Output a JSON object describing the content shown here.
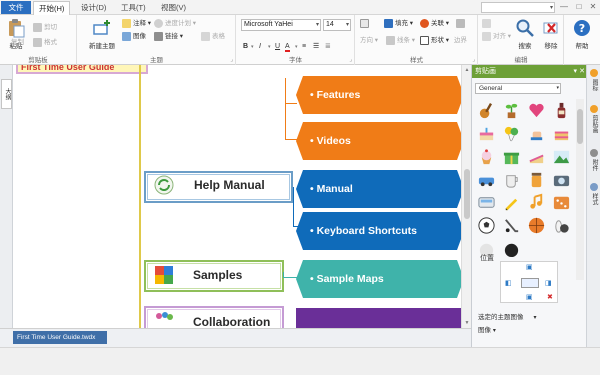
{
  "menu": {
    "file": "文件(F)",
    "start": "开始(H)",
    "design": "设计(D)",
    "tools": "工具(T)",
    "view": "视图(V)"
  },
  "window": {
    "minimize": "—",
    "restore": "□",
    "close": "✕"
  },
  "ribbon": {
    "clipboard": {
      "paste": "粘贴",
      "copy": "复制",
      "cut": "剪切",
      "format_painter": "格式",
      "label": "剪贴板"
    },
    "topic": {
      "new_topic": "新建主题",
      "note": "注释",
      "progress": "进度计划",
      "image": "图像",
      "link": "链接",
      "table": "表格",
      "label": "主题"
    },
    "font": {
      "family": "Microsoft YaHei",
      "size": "14",
      "bold": "B",
      "italic": "I",
      "underline": "U",
      "label": "字体"
    },
    "style": {
      "fill": "填充",
      "connect": "关联",
      "direction": "方向",
      "line_color": "线条",
      "shape": "形状",
      "border": "边界",
      "label": "样式"
    },
    "edit": {
      "align": "对齐",
      "search": "搜索",
      "remove": "移除",
      "label": "编辑"
    },
    "help": {
      "help": "帮助"
    }
  },
  "left_panel": {
    "tab": "大纲"
  },
  "canvas": {
    "top_topic": "First Time User Guide",
    "topics": [
      {
        "label": "Help Manual"
      },
      {
        "label": "Samples"
      },
      {
        "label": "Collaboration"
      }
    ],
    "subtopics": [
      {
        "label": "• Features"
      },
      {
        "label": "• Videos"
      },
      {
        "label": "• Manual"
      },
      {
        "label": "• Keyboard Shortcuts"
      },
      {
        "label": "• Sample Maps"
      }
    ]
  },
  "doc_tab": "First Time User Guide.twdx",
  "right_panel": {
    "title": "剪贴画",
    "category": "General",
    "position_label": "位置",
    "selected_image_label": "选定的主题图像",
    "image_label": "图像"
  },
  "right_strip": {
    "tabs": [
      "图标",
      "剪贴画",
      "附件",
      "样式"
    ]
  },
  "colors": {
    "orange": "#f07c17",
    "blue": "#0f6bba",
    "teal": "#3fb3aa",
    "purple": "#6a2f98",
    "panel_header": "#6da037",
    "file_menu": "#2b6fc1"
  }
}
